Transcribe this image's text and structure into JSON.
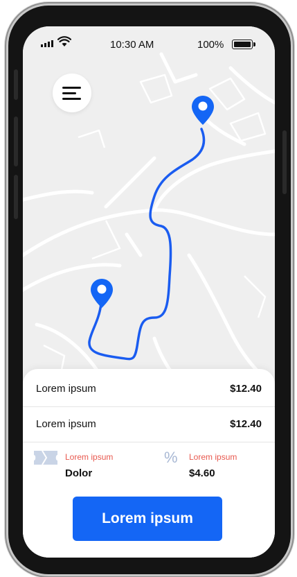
{
  "status_bar": {
    "time": "10:30 AM",
    "battery_percent": "100%",
    "battery_level": 1.0
  },
  "menu": {
    "icon": "hamburger-menu-icon"
  },
  "map": {
    "route_color": "#1a5cf0",
    "pin_color": "#1466f5",
    "origin_icon": "map-pin-icon",
    "destination_icon": "map-pin-icon"
  },
  "summary": {
    "rows": [
      {
        "label": "Lorem ipsum",
        "amount": "$12.40"
      },
      {
        "label": "Lorem ipsum",
        "amount": "$12.40"
      }
    ],
    "details": [
      {
        "icon": "ticket-icon",
        "label": "Lorem ipsum",
        "value": "Dolor"
      },
      {
        "icon": "percent-icon",
        "label": "Lorem ipsum",
        "value": "$4.60"
      }
    ]
  },
  "cta": {
    "label": "Lorem ipsum",
    "color": "#1466f5"
  },
  "colors": {
    "accent": "#1466f5",
    "secondary_text": "#e8584e"
  }
}
